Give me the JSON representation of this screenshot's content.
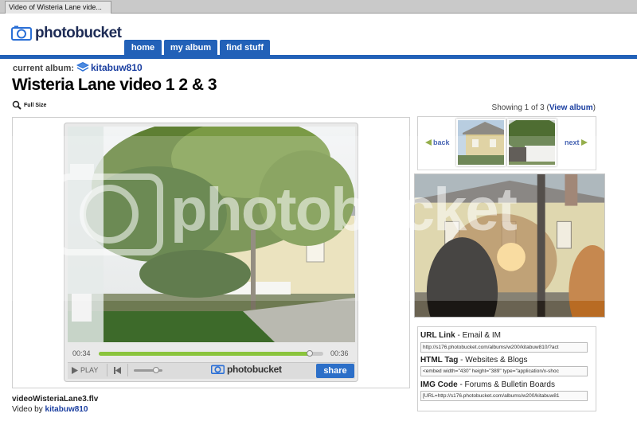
{
  "browser": {
    "tab_title": "Video of Wisteria Lane vide..."
  },
  "site": {
    "logo_text": "photobucket"
  },
  "nav": {
    "home": "home",
    "my_album": "my album",
    "find_stuff": "find stuff"
  },
  "album": {
    "current_label": "current album:",
    "name": "kitabuw810"
  },
  "page": {
    "title": "Wisteria Lane video  1 2 & 3",
    "full_size": "Full Size"
  },
  "pager": {
    "showing_text": "Showing 1 of 3 (",
    "view_album": "View album",
    "close_paren": ")",
    "back": "back",
    "next": "next"
  },
  "player": {
    "time_elapsed": "00:34",
    "time_total": "00:36",
    "progress": 0.94,
    "play_label": "PLAY",
    "brand": "photobucket",
    "share_label": "share"
  },
  "codes": {
    "url": {
      "title": "URL Link",
      "subtitle": " - Email & IM",
      "value": "http://s176.photobucket.com/albums/w200/kitabuw810/?act"
    },
    "html": {
      "title": "HTML Tag",
      "subtitle": " - Websites & Blogs",
      "value": "<embed width=\"430\" height=\"389\" type=\"application/x-shoc"
    },
    "img": {
      "title": "IMG Code",
      "subtitle": " - Forums & Bulletin Boards",
      "value": "[URL=http://s176.photobucket.com/albums/w200/kitabuw81"
    }
  },
  "footer": {
    "filename": "videoWisteriaLane3.flv",
    "video_by": "Video by ",
    "author": "kitabuw810"
  },
  "watermark": {
    "text": "photobucket"
  },
  "colors": {
    "brand_blue": "#2261b8",
    "link_blue": "#1a3ea0",
    "progress_green": "#8ac43c"
  }
}
